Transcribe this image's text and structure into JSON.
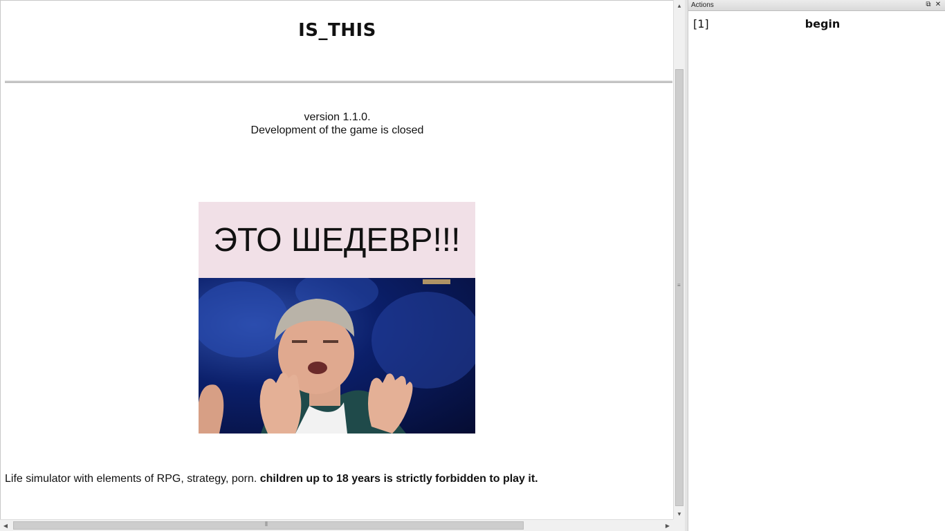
{
  "main": {
    "title": "IS_THIS",
    "version": "version 1.1.0.",
    "dev_status": "Development of the game is closed",
    "meme_caption": "ЭТО ШЕДЕВР!!!",
    "description_plain": "Life simulator with elements of RPG, strategy, porn. ",
    "description_bold": "children up to 18 years is strictly forbidden to play it."
  },
  "actions": {
    "header_title": "Actions",
    "items": [
      {
        "index": "[1]",
        "label": "begin"
      }
    ]
  },
  "icons": {
    "maximize": "window-maximize-icon",
    "close": "close-icon",
    "scroll_up": "arrow-up-icon",
    "scroll_down": "arrow-down-icon",
    "scroll_left": "arrow-left-icon",
    "scroll_right": "arrow-right-icon"
  },
  "colors": {
    "meme_caption_bg": "#f1e0e7",
    "meme_photo_bg": "#0b1f6a"
  }
}
